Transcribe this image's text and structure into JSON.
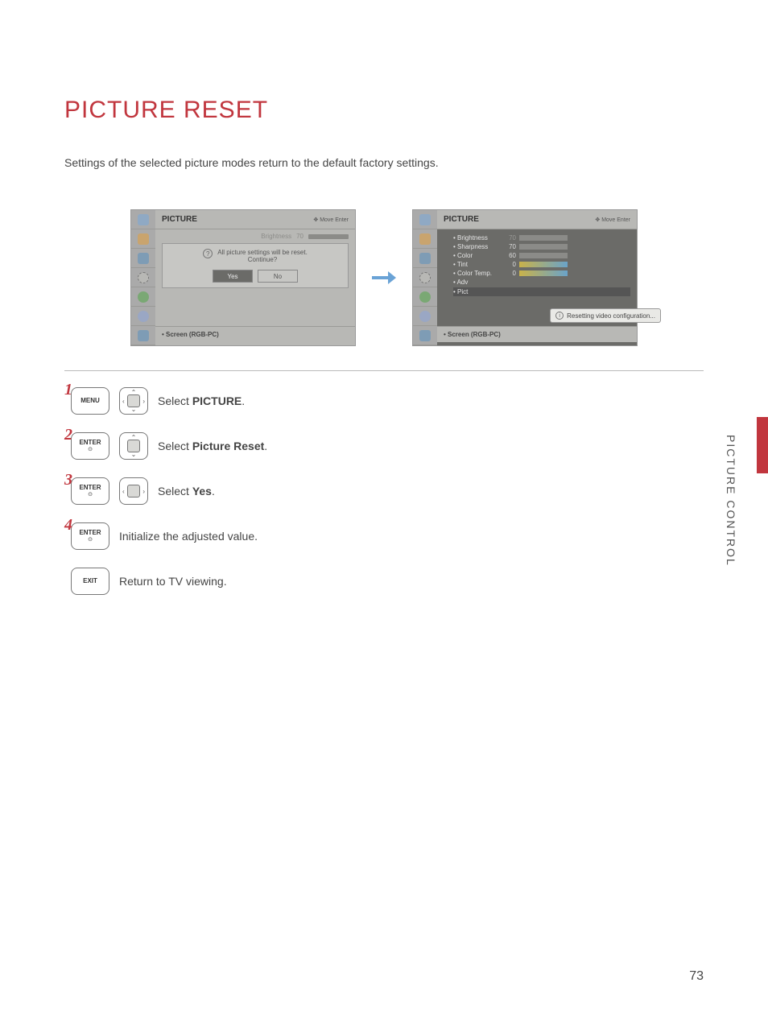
{
  "title": "PICTURE RESET",
  "intro": "Settings of the selected picture modes return to the default factory settings.",
  "side_label": "PICTURE CONTROL",
  "page_number": "73",
  "screen_left": {
    "header_title": "PICTURE",
    "header_hint": "Move   Enter",
    "faded_label": "Brightness",
    "faded_value": "70",
    "dialog_line1": "All picture settings will be reset.",
    "dialog_line2": "Continue?",
    "yes": "Yes",
    "no": "No",
    "footer": "• Screen (RGB-PC)"
  },
  "screen_right": {
    "header_title": "PICTURE",
    "header_hint": "Move   Enter",
    "rows": [
      {
        "label": "Brightness",
        "value": "70",
        "fill": 70,
        "faded": true
      },
      {
        "label": "Sharpness",
        "value": "70",
        "fill": 70
      },
      {
        "label": "Color",
        "value": "60",
        "fill": 60
      },
      {
        "label": "Tint",
        "value": "0",
        "rg": true
      },
      {
        "label": "Color Temp.",
        "value": "0",
        "rg": true
      },
      {
        "label": "Adv",
        "value": "",
        "plain": true
      },
      {
        "label": "Pict",
        "value": "",
        "plain": true,
        "sel": true
      }
    ],
    "toast": "Resetting video configuration...",
    "footer": "• Screen (RGB-PC)"
  },
  "steps": {
    "s1": {
      "key": "MENU",
      "text_pre": "Select ",
      "bold": "PICTURE",
      "text_post": "."
    },
    "s2": {
      "key": "ENTER",
      "text_pre": "Select ",
      "bold": "Picture Reset",
      "text_post": "."
    },
    "s3": {
      "key": "ENTER",
      "text_pre": "Select ",
      "bold": "Yes",
      "text_post": "."
    },
    "s4": {
      "key": "ENTER",
      "text": "Initialize the adjusted value."
    },
    "s5": {
      "key": "EXIT",
      "text": "Return to TV viewing."
    }
  }
}
